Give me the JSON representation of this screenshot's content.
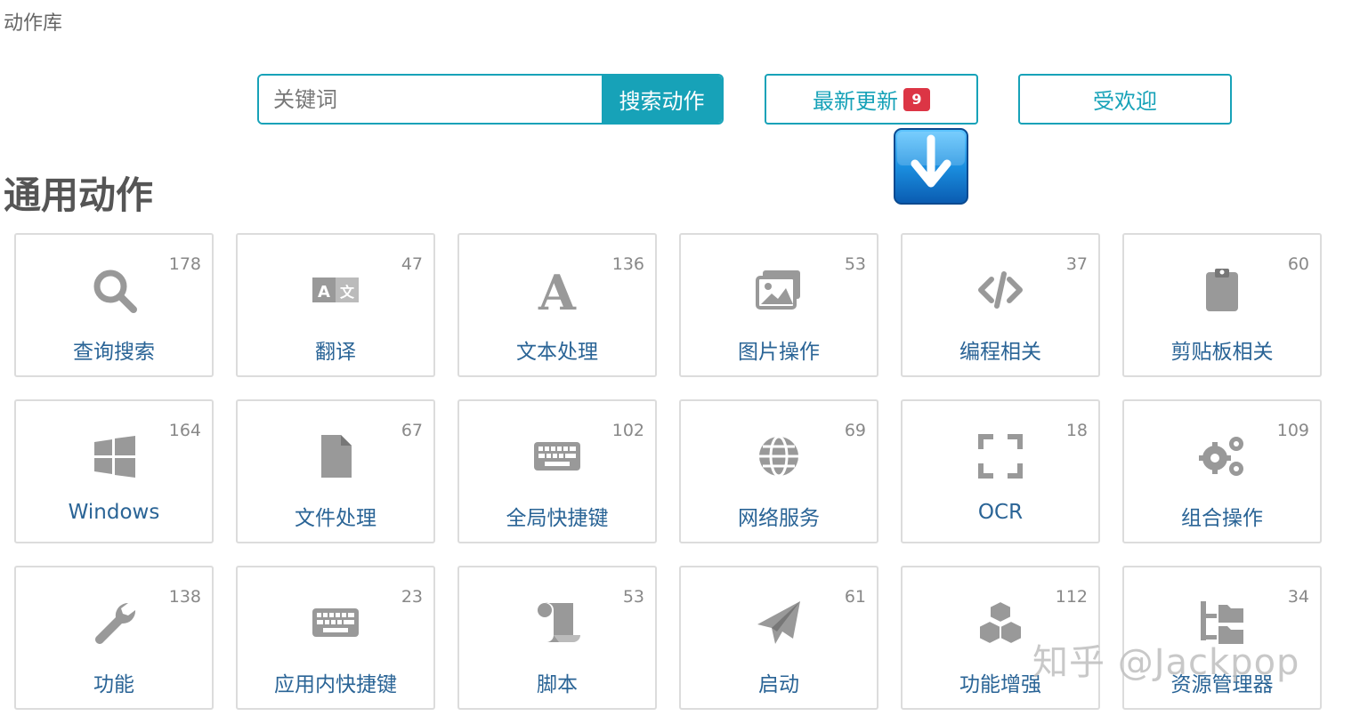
{
  "breadcrumb": "动作库",
  "search": {
    "placeholder": "关键词",
    "button_label": "搜索动作"
  },
  "buttons": {
    "latest_label": "最新更新",
    "latest_badge": "9",
    "popular_label": "受欢迎"
  },
  "section_title": "通用动作",
  "colors": {
    "accent": "#17a2b8",
    "badge": "#dc3545",
    "label": "#2a6496",
    "icon": "#999999"
  },
  "categories": [
    {
      "label": "查询搜索",
      "count": "178",
      "icon": "search-icon"
    },
    {
      "label": "翻译",
      "count": "47",
      "icon": "translate-icon"
    },
    {
      "label": "文本处理",
      "count": "136",
      "icon": "font-icon"
    },
    {
      "label": "图片操作",
      "count": "53",
      "icon": "images-icon"
    },
    {
      "label": "编程相关",
      "count": "37",
      "icon": "code-icon"
    },
    {
      "label": "剪贴板相关",
      "count": "60",
      "icon": "clipboard-icon"
    },
    {
      "label": "Windows",
      "count": "164",
      "icon": "windows-icon"
    },
    {
      "label": "文件处理",
      "count": "67",
      "icon": "file-icon"
    },
    {
      "label": "全局快捷键",
      "count": "102",
      "icon": "keyboard-icon"
    },
    {
      "label": "网络服务",
      "count": "69",
      "icon": "globe-icon"
    },
    {
      "label": "OCR",
      "count": "18",
      "icon": "expand-icon"
    },
    {
      "label": "组合操作",
      "count": "109",
      "icon": "cogs-icon"
    },
    {
      "label": "功能",
      "count": "138",
      "icon": "wrench-icon"
    },
    {
      "label": "应用内快捷键",
      "count": "23",
      "icon": "keyboard-icon"
    },
    {
      "label": "脚本",
      "count": "53",
      "icon": "scroll-icon"
    },
    {
      "label": "启动",
      "count": "61",
      "icon": "paper-plane-icon"
    },
    {
      "label": "功能增强",
      "count": "112",
      "icon": "cubes-icon"
    },
    {
      "label": "资源管理器",
      "count": "34",
      "icon": "folder-tree-icon"
    }
  ],
  "watermark": "知乎 @Jackpop"
}
